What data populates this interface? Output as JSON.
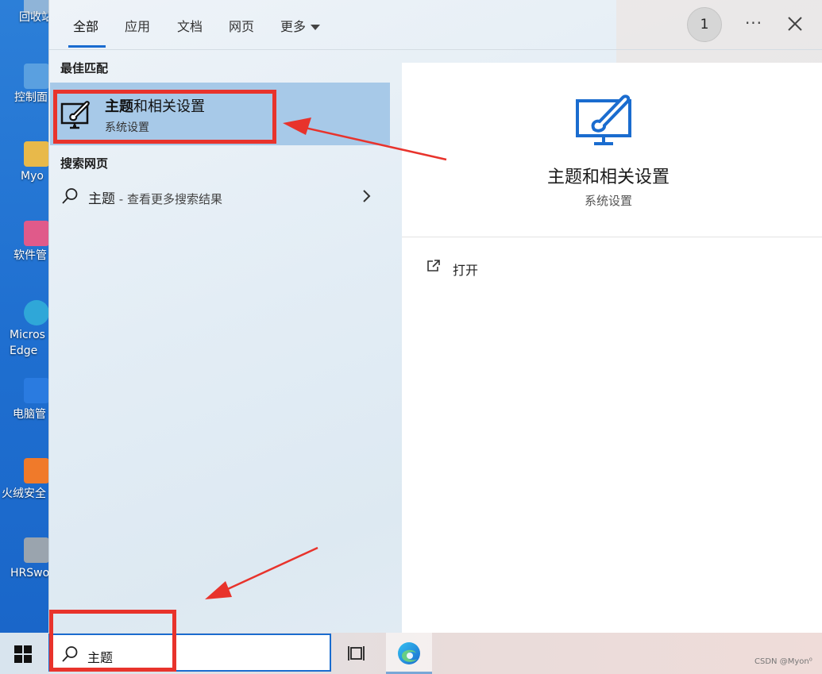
{
  "desktop": {
    "icons": [
      {
        "label": "回收站",
        "color": "#8fb4d8"
      },
      {
        "label": "控制面",
        "color": "#5aa0e0"
      },
      {
        "label": "Myo",
        "color": "#e8b94a"
      },
      {
        "label": "软件管",
        "color": "#e05a8a"
      },
      {
        "label": "Micros\nEdge",
        "color": "#2fa7d8"
      },
      {
        "label": "电脑管",
        "color": "#2a7be0"
      },
      {
        "label": "火绒安全",
        "color": "#f07a2a"
      },
      {
        "label": "HRSwo",
        "color": "#9aa4ae"
      }
    ]
  },
  "tabs": [
    {
      "label": "全部",
      "active": true
    },
    {
      "label": "应用",
      "active": false
    },
    {
      "label": "文档",
      "active": false
    },
    {
      "label": "网页",
      "active": false
    },
    {
      "label": "更多",
      "active": false,
      "dropdown": true
    }
  ],
  "header": {
    "badge": "1",
    "more_icon": "more-horizontal-icon",
    "close_icon": "close-icon"
  },
  "best_match": {
    "heading": "最佳匹配",
    "title_bold": "主题",
    "title_rest": "和相关设置",
    "subtitle": "系统设置",
    "icon": "theme-brush-icon"
  },
  "web_search": {
    "heading": "搜索网页",
    "query": "主题",
    "suffix": " - 查看更多搜索结果"
  },
  "detail": {
    "title": "主题和相关设置",
    "subtitle": "系统设置",
    "actions": [
      {
        "label": "打开",
        "icon": "open-external-icon"
      }
    ]
  },
  "taskbar": {
    "search_value": "主题",
    "watermark": "CSDN @Myon⁰"
  },
  "colors": {
    "accent": "#1a6ccf",
    "selection": "#a7c9e8",
    "annotation": "#e8332c"
  }
}
